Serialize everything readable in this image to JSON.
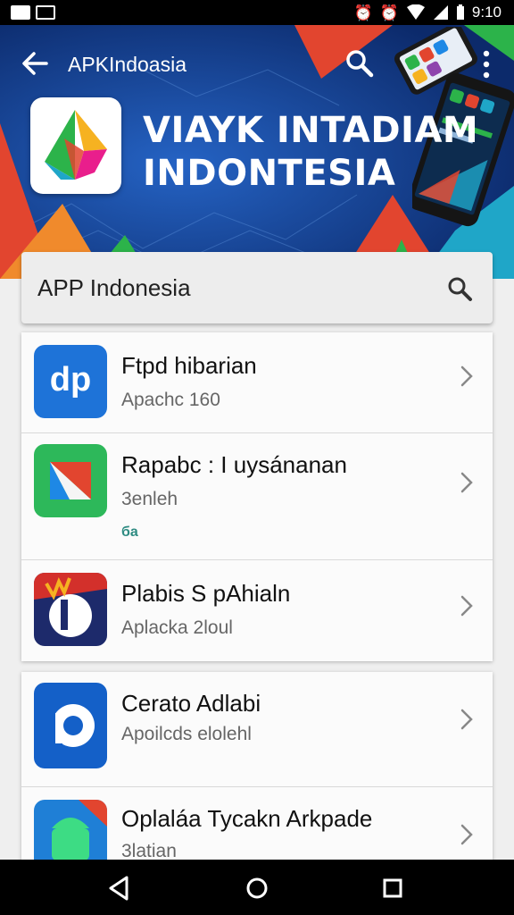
{
  "status_bar": {
    "left_badge": "€▐▐",
    "time": "9:10",
    "icons": [
      "alarm-icon",
      "alarm-icon",
      "wifi-icon",
      "signal-icon",
      "battery-icon"
    ]
  },
  "app_bar": {
    "title": "APKIndoasia",
    "icons": [
      "back-arrow-icon",
      "search-icon",
      "more-vert-icon"
    ]
  },
  "hero": {
    "title_line1": "VIAYK INTADIAM",
    "title_line2": "INDONTESIA",
    "colors": {
      "background": "#0f3a86",
      "accent_red": "#e2452f",
      "accent_green": "#2cb34a",
      "accent_teal": "#1fa6c8"
    }
  },
  "search": {
    "value": "",
    "placeholder": "APP Indonesia",
    "icon": "search-icon"
  },
  "list": {
    "items": [
      {
        "title": "Ftpd hibarian",
        "subtitle": "Apachc 160",
        "icon_text": "dp",
        "icon": "dp-app-icon"
      },
      {
        "title": "Rapabc : I uysánanan",
        "subtitle": "3enleh",
        "extra": "ба",
        "icon": "red-green-app-icon"
      },
      {
        "title": "Plabis S pAhialn",
        "subtitle": "Aplacka 2loul",
        "icon": "fire-badge-app-icon"
      },
      {
        "title": "Cerato Adlabi",
        "subtitle": "Apoilcds elolehl",
        "icon": "blue-p-app-icon"
      },
      {
        "title": "Oplaláa Tycakn Arkpade",
        "subtitle": "3latian",
        "icon": "android-app-icon"
      }
    ]
  },
  "nav_bar": {
    "icons": [
      "back-triangle-icon",
      "home-circle-icon",
      "recents-square-icon"
    ]
  }
}
